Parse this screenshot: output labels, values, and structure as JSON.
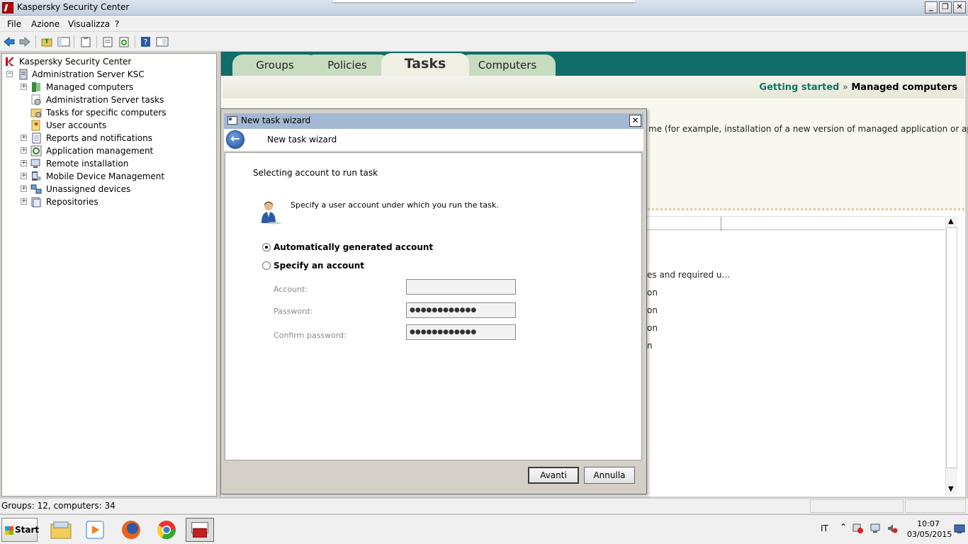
{
  "window": {
    "title": "Kaspersky Security Center",
    "minimize": "_",
    "restore": "❐",
    "close": "✕"
  },
  "menu": [
    "File",
    "Azione",
    "Visualizza",
    "?"
  ],
  "tree": {
    "root": "Kaspersky Security Center",
    "server": "Administration Server KSC",
    "items": [
      {
        "label": "Managed computers",
        "expandable": true
      },
      {
        "label": "Administration Server tasks",
        "expandable": false
      },
      {
        "label": "Tasks for specific computers",
        "expandable": false
      },
      {
        "label": "User accounts",
        "expandable": false
      },
      {
        "label": "Reports and notifications",
        "expandable": true
      },
      {
        "label": "Application management",
        "expandable": true
      },
      {
        "label": "Remote installation",
        "expandable": true
      },
      {
        "label": "Mobile Device Management",
        "expandable": true
      },
      {
        "label": "Unassigned devices",
        "expandable": true
      },
      {
        "label": "Repositories",
        "expandable": true
      }
    ]
  },
  "tabs": [
    "Groups",
    "Policies",
    "Tasks",
    "Computers"
  ],
  "active_tab": "Tasks",
  "breadcrumb": {
    "link": "Getting started",
    "sep": "»",
    "current": "Managed computers"
  },
  "description_fragment": "me (for example, installation of a new version of managed application or application",
  "list_fragments": [
    "es and required u...",
    "on",
    "on",
    "on",
    "n"
  ],
  "status": {
    "text": "Groups: 12, computers: 34"
  },
  "taskbar": {
    "start": "Start",
    "lang": "IT",
    "time": "10:07",
    "date": "03/05/2015"
  },
  "dialog": {
    "title": "New task wizard",
    "header": "New task wizard",
    "step_title": "Selecting account to run task",
    "hint": "Specify a user account under which you run the task.",
    "radio_auto": "Automatically generated account",
    "radio_specify": "Specify an account",
    "selected": "auto",
    "account_label": "Account:",
    "account_value": "",
    "password_label": "Password:",
    "password_value": "●●●●●●●●●●●●",
    "confirm_label": "Confirm password:",
    "confirm_value": "●●●●●●●●●●●●",
    "next_button": "Avanti",
    "cancel_button": "Annulla",
    "close_glyph": "✕",
    "back_glyph": "←"
  },
  "colors": {
    "tab_strip": "#0f6d6a",
    "tab": "#c7dbbf",
    "breadcrumb_link": "#0a7a64",
    "dialog_title": "#a3b8d2"
  }
}
